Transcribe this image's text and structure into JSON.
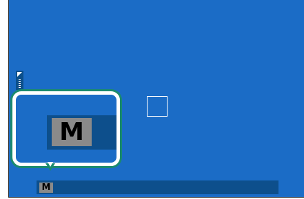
{
  "viewfinder": {
    "shooting_mode_large": "M",
    "shooting_mode_small": "M",
    "exposure_indicator_icon": "exposure-compensation-icon",
    "focus_frame_icon": "focus-frame-icon",
    "colors": {
      "background": "#1b6cc6",
      "bar": "#0d4f8c",
      "badge": "#8a8a8a",
      "callout_border": "#1a8a6e"
    }
  }
}
